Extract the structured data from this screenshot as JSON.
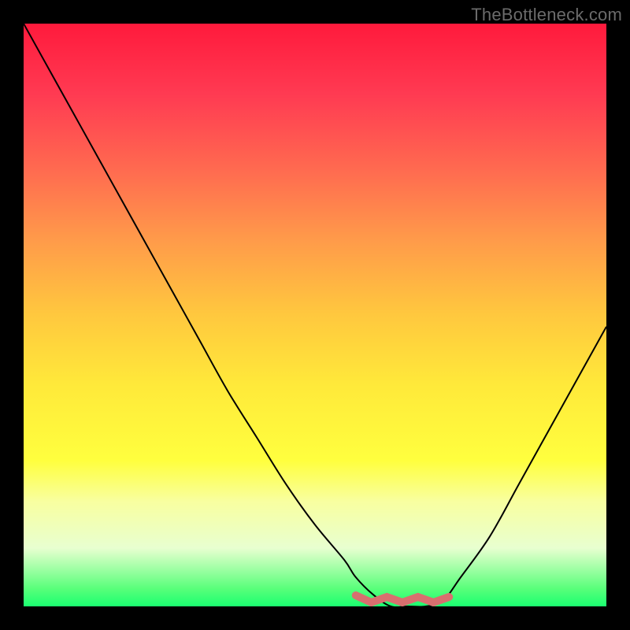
{
  "watermark": "TheBottleneck.com",
  "chart_data": {
    "type": "line",
    "title": "",
    "xlabel": "",
    "ylabel": "",
    "ylim": [
      0,
      100
    ],
    "xlim": [
      0,
      100
    ],
    "x": [
      0,
      5,
      10,
      15,
      20,
      25,
      30,
      35,
      40,
      45,
      50,
      55,
      57,
      60,
      63,
      66,
      69,
      72,
      75,
      80,
      85,
      90,
      95,
      100
    ],
    "y": [
      100,
      91,
      82,
      73,
      64,
      55,
      46,
      37,
      29,
      21,
      14,
      8,
      5,
      2,
      0,
      0,
      0,
      1,
      5,
      12,
      21,
      30,
      39,
      48
    ],
    "background_gradient_semantics": "vertical red-to-green gradient (red high, green low)",
    "highlight": {
      "x_range": [
        57,
        73
      ],
      "color": "#d86f6f",
      "description": "small bumpy red overlay near valley bottom"
    }
  },
  "colors": {
    "page_bg": "#000000",
    "curve": "#000000",
    "highlight": "#d86f6f",
    "watermark": "#6b6b6b"
  }
}
